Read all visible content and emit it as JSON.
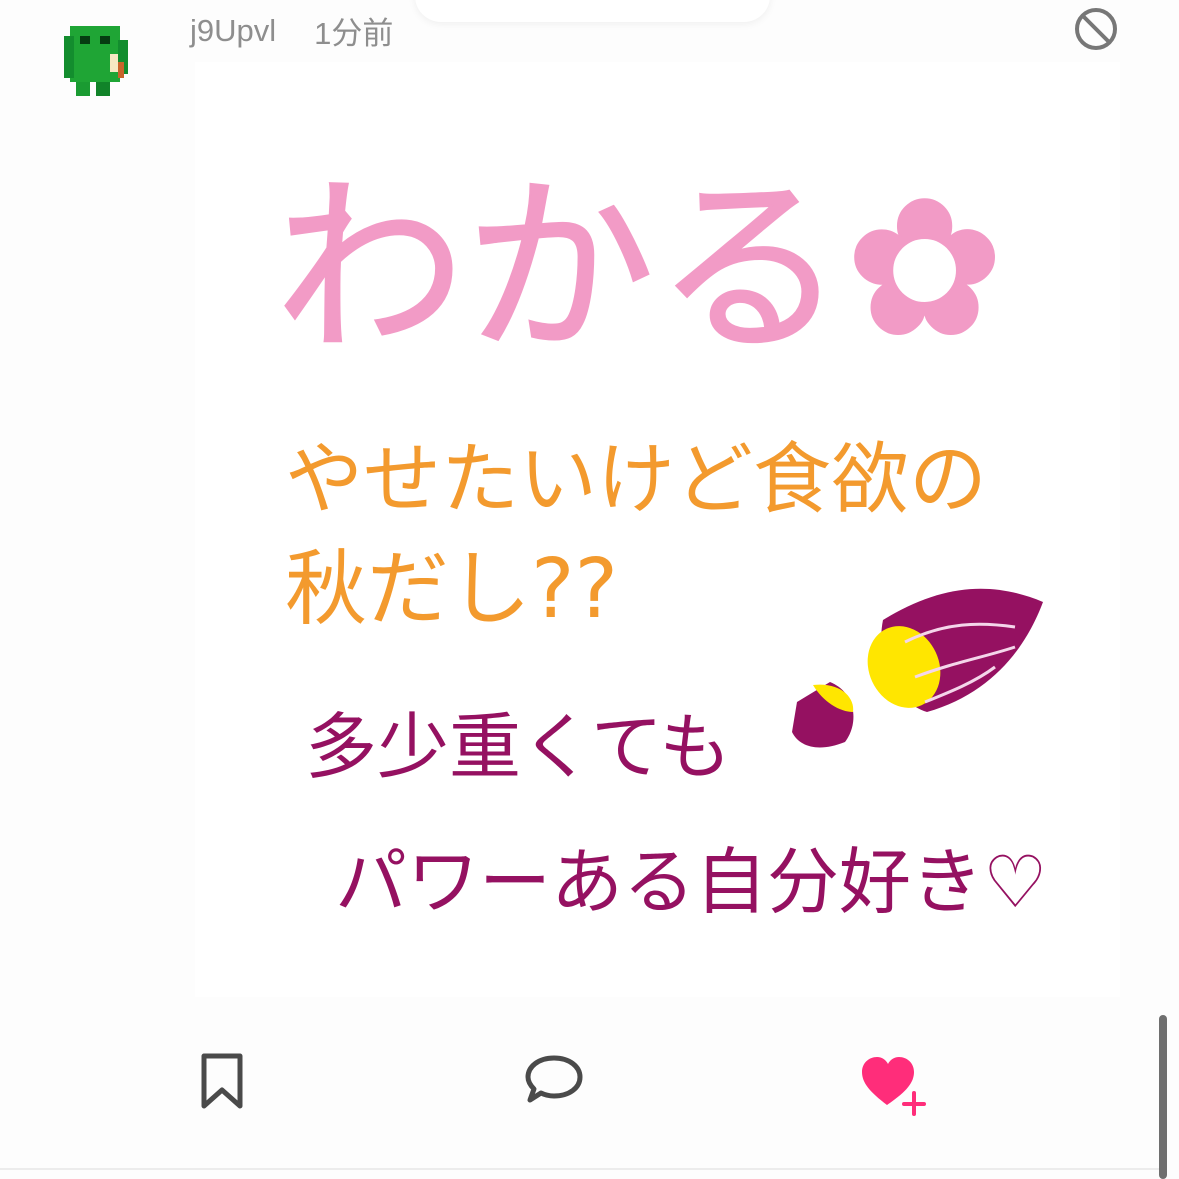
{
  "post": {
    "author": "j9Upvl",
    "time": "1分前",
    "avatar_icon": "green-block-character-avatar",
    "block_icon": "block-icon"
  },
  "drawing": {
    "line1": "わかる✿",
    "line2": "やせたいけど食欲の",
    "line3": "秋だし??",
    "line4": "多少重くても",
    "line5": "パワーある自分好き♡",
    "colors": {
      "pink": "#f29bc6",
      "orange": "#f39a2e",
      "purple": "#951161",
      "potato_yellow": "#ffe600"
    }
  },
  "actions": {
    "bookmark_icon": "bookmark-icon",
    "comment_icon": "comment-icon",
    "like_icon": "heart-plus-icon",
    "like_color": "#ff2d7a"
  }
}
